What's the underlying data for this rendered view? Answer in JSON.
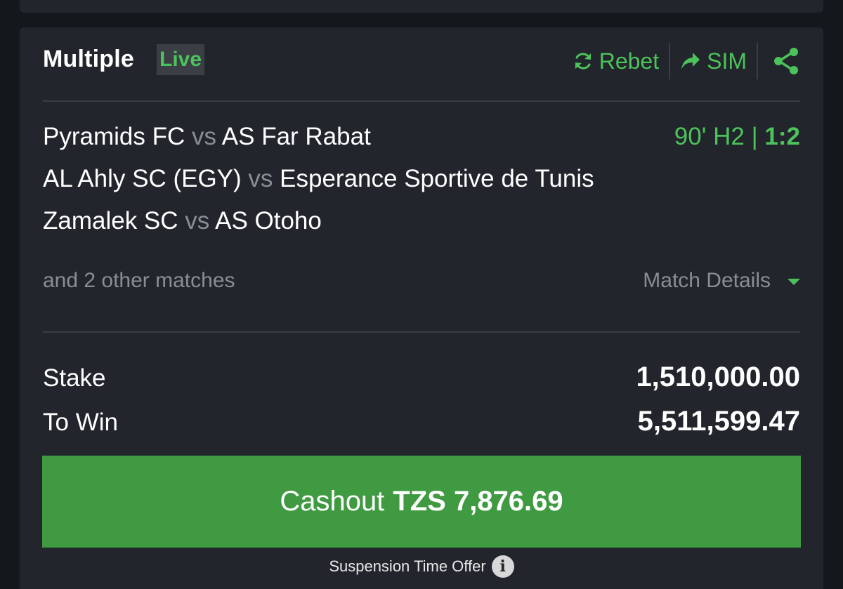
{
  "bet": {
    "type_label": "Multiple",
    "live_badge": "Live"
  },
  "actions": {
    "rebet_label": "Rebet",
    "sim_label": "SIM"
  },
  "matches": [
    {
      "home": "Pyramids FC",
      "vs": "vs",
      "away": "AS Far Rabat"
    },
    {
      "home": "AL Ahly SC (EGY)",
      "vs": "vs",
      "away": "Esperance Sportive de Tunis"
    },
    {
      "home": "Zamalek SC",
      "vs": "vs",
      "away": "AS Otoho"
    }
  ],
  "live_status": {
    "time": "90' H2",
    "divider": "|",
    "score": "1:2"
  },
  "other_matches": "and 2 other matches",
  "match_details_label": "Match Details",
  "stake": {
    "label": "Stake",
    "value": "1,510,000.00"
  },
  "to_win": {
    "label": "To Win",
    "value": "5,511,599.47"
  },
  "cashout": {
    "label": "Cashout",
    "amount": "TZS 7,876.69"
  },
  "suspension_label": "Suspension Time Offer",
  "icons": [
    "refresh-icon",
    "share-arrow-icon",
    "share-icon",
    "chevron-down-icon",
    "info-icon"
  ],
  "colors": {
    "accent": "#4cc35a",
    "button": "#3f9a41",
    "card": "#22252c",
    "background": "#14171c"
  }
}
